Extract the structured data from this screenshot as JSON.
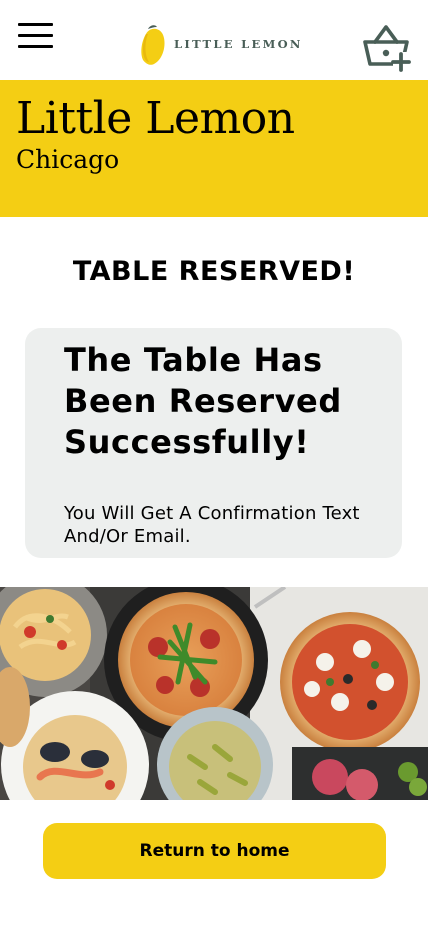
{
  "header": {
    "logo_text": "LITTLE LEMON",
    "menu_icon": "hamburger-menu-icon",
    "cart_icon": "basket-add-icon"
  },
  "hero": {
    "title": "Little Lemon",
    "subtitle": "Chicago"
  },
  "main": {
    "heading": "TABLE RESERVED!",
    "card": {
      "title": "The Table Has Been Reserved Successfully!",
      "message": "You Will Get A Confirmation Text And/Or Email."
    },
    "return_button_label": "Return to home"
  },
  "colors": {
    "primary_yellow": "#f4ce14",
    "primary_green": "#495e57",
    "card_background": "#edefee"
  }
}
